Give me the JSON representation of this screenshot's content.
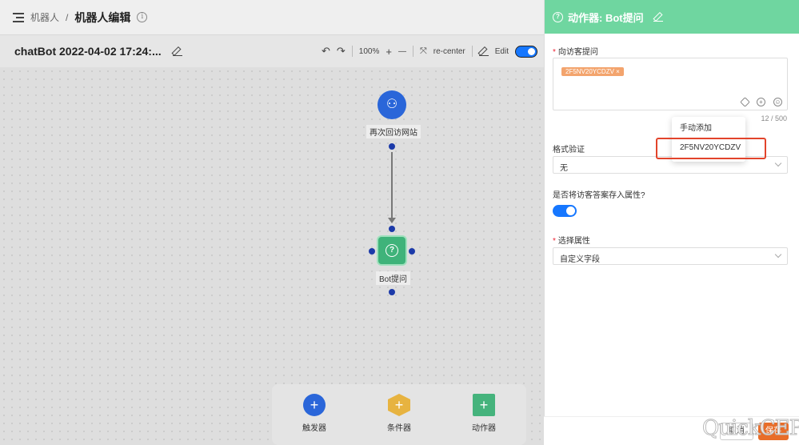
{
  "breadcrumb": {
    "parent": "机器人",
    "separator": "/",
    "current": "机器人编辑"
  },
  "toolbar": {
    "bot_name": "chatBot 2022-04-02 17:24:...",
    "zoom": "100%",
    "zoom_in": "+",
    "zoom_out": "—",
    "recenter_label": "re-center",
    "edit_label": "Edit"
  },
  "nodes": {
    "trigger_label": "再次回访网站",
    "action_label": "Bot提问"
  },
  "palette": [
    {
      "label": "触发器",
      "icon": "plus-icon",
      "color": "#2a66d9"
    },
    {
      "label": "条件器",
      "icon": "plus-icon",
      "color": "#e7b340"
    },
    {
      "label": "动作器",
      "icon": "plus-icon",
      "color": "#45b37c"
    }
  ],
  "panel": {
    "title": "动作器: Bot提问",
    "header_color": "#6fd6a0",
    "question_label": "向访客提问",
    "question_chip": "2F5NV20YCDZV",
    "char_count": "12 / 500",
    "validation_label": "格式验证",
    "validation_value": "无",
    "save_attr_label": "是否将访客答案存入属性?",
    "attr_label": "选择属性",
    "attr_value": "自定义字段",
    "cancel_label": "取消",
    "save_label": "保存"
  },
  "popup": {
    "options": [
      "手动添加",
      "2F5NV20YCDZV"
    ]
  },
  "watermark": "QuickCEP"
}
